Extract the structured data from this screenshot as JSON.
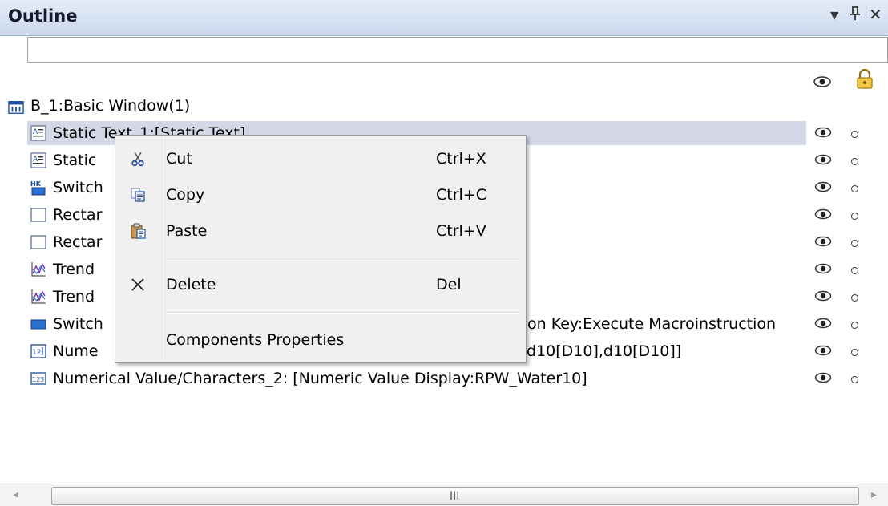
{
  "panel": {
    "title": "Outline",
    "menu_glyph": "▾",
    "pin_glyph": "ᚹ",
    "close_glyph": "✕",
    "search_value": ""
  },
  "header_icons": [
    "eye-icon",
    "lock-icon"
  ],
  "tree": {
    "root": {
      "label": "B_1:Basic Window(1)",
      "icon": "window-icon"
    },
    "items": [
      {
        "label": "Static Text_1:[Static Text]",
        "icon": "static-text-icon",
        "selected": true
      },
      {
        "label": "Static",
        "icon": "static-text-icon"
      },
      {
        "label": "Switch",
        "icon": "hotkey-switch-icon"
      },
      {
        "label": "Rectar",
        "icon": "rectangle-icon"
      },
      {
        "label": "Rectar",
        "icon": "rectangle-icon"
      },
      {
        "label": "Trend",
        "icon": "trend-icon"
      },
      {
        "label": "Trend",
        "icon": "trend-icon"
      },
      {
        "label": "Switch",
        "tail": "on Key:Execute Macroinstruction",
        "icon": "switch-icon"
      },
      {
        "label": "Nume",
        "tail": "d10[D10],d10[D10]]",
        "icon": "numeric-input-icon"
      },
      {
        "label": "Numerical Value/Characters_2: [Numeric Value Display:RPW_Water10]",
        "icon": "numeric-display-icon"
      }
    ]
  },
  "context_menu": {
    "items": [
      {
        "label": "Cut",
        "shortcut": "Ctrl+X",
        "icon": "scissors-icon"
      },
      {
        "label": "Copy",
        "shortcut": "Ctrl+C",
        "icon": "copy-icon"
      },
      {
        "label": "Paste",
        "shortcut": "Ctrl+V",
        "icon": "paste-icon"
      },
      {
        "label": "Delete",
        "shortcut": "Del",
        "icon": "delete-x-icon"
      },
      {
        "label": "Components Properties",
        "shortcut": "",
        "icon": ""
      }
    ]
  },
  "scrollbar": {
    "left_arrow": "◂",
    "right_arrow": "▸",
    "grip": "III"
  },
  "colors": {
    "titlebar": "#d6e2f3",
    "selection": "#d4d8e6",
    "menu_bg": "#f0f0f0"
  }
}
